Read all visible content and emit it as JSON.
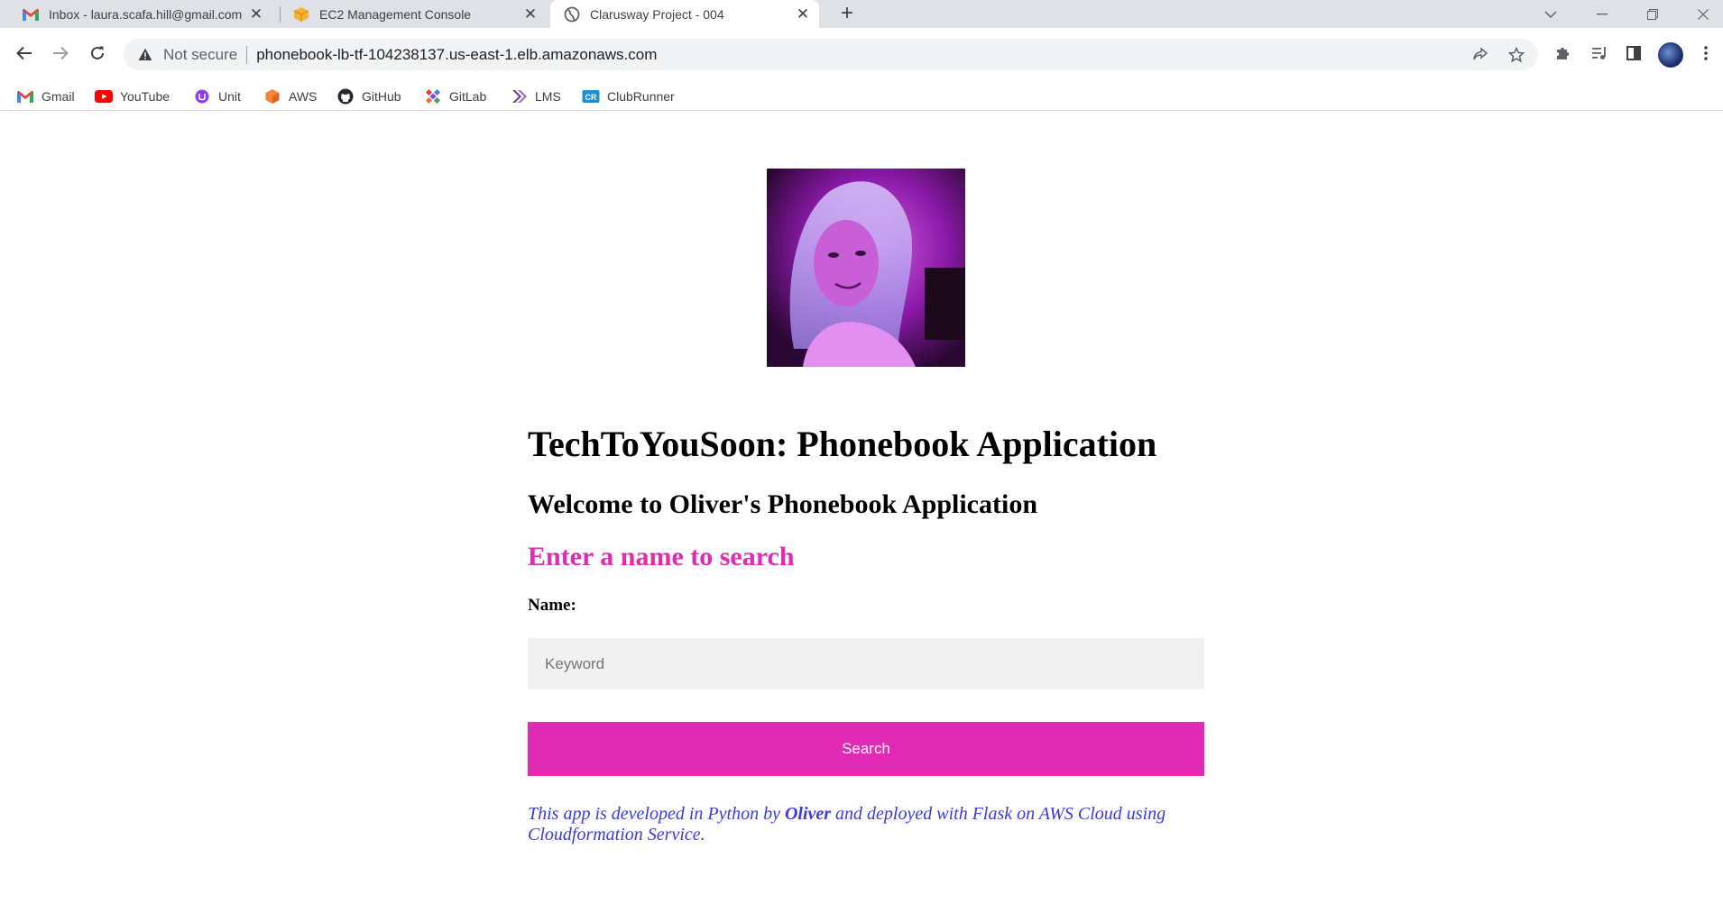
{
  "browser": {
    "tabs": [
      {
        "title": "Inbox - laura.scafa.hill@gmail.com",
        "favicon": "gmail-icon",
        "active": false
      },
      {
        "title": "EC2 Management Console",
        "favicon": "aws-box-icon",
        "active": false
      },
      {
        "title": "Clarusway Project - 004",
        "favicon": "globe-icon",
        "active": true
      }
    ],
    "close_glyph": "✕",
    "new_tab_glyph": "+",
    "address": {
      "security_label": "Not secure",
      "url": "phonebook-lb-tf-104238137.us-east-1.elb.amazonaws.com"
    },
    "bookmarks": [
      {
        "label": "Gmail",
        "icon": "gmail-icon"
      },
      {
        "label": "YouTube",
        "icon": "youtube-icon"
      },
      {
        "label": "Unit",
        "icon": "unit-icon"
      },
      {
        "label": "AWS",
        "icon": "aws-icon"
      },
      {
        "label": "GitHub",
        "icon": "github-icon"
      },
      {
        "label": "GitLab",
        "icon": "gitlab-icon"
      },
      {
        "label": "LMS",
        "icon": "lms-icon"
      },
      {
        "label": "ClubRunner",
        "icon": "clubrunner-icon"
      }
    ]
  },
  "page": {
    "heading": "TechToYouSoon: Phonebook Application",
    "welcome": "Welcome to Oliver's Phonebook Application",
    "search_prompt": "Enter a name to search",
    "name_label": "Name:",
    "keyword_placeholder": "Keyword",
    "search_button": "Search",
    "footer": {
      "prefix": "This app is developed in Python by ",
      "author": "Oliver",
      "suffix": " and deployed with Flask on AWS Cloud using Cloudformation Service."
    }
  },
  "colors": {
    "accent_pink": "#e12bb5",
    "footer_blue": "#3a3ae0",
    "input_bg": "#f1f1f1"
  }
}
